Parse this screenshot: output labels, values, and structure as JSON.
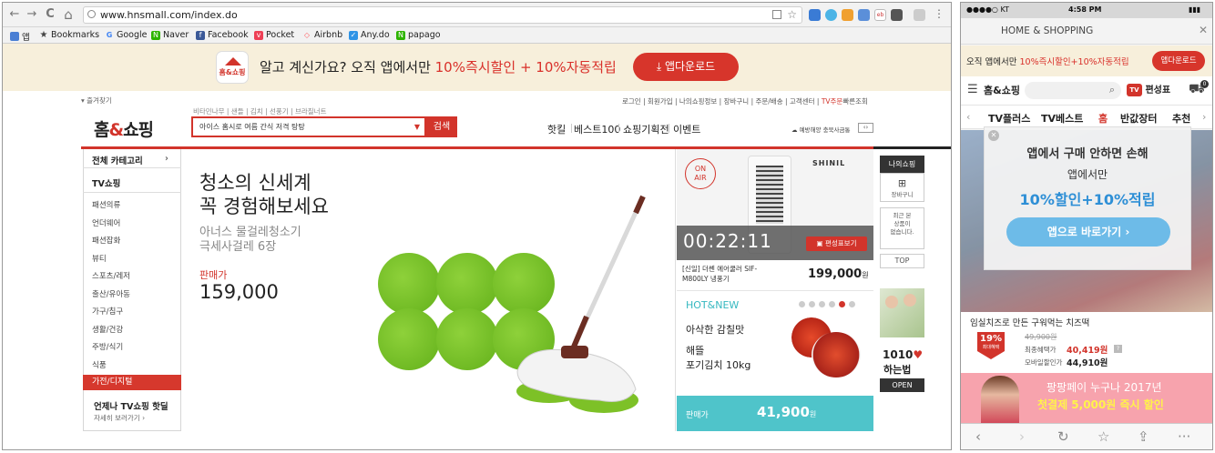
{
  "desktop": {
    "nav_icons": {
      "back": "←",
      "forward": "→",
      "reload": "C",
      "home": "⌂"
    },
    "url": "www.hnsmall.com/index.do",
    "bookmarks": [
      {
        "label": "앱",
        "icon": "apps-icon"
      },
      {
        "label": "Bookmarks",
        "icon": "star-icon"
      },
      {
        "label": "Google",
        "icon": "google-icon"
      },
      {
        "label": "Naver",
        "icon": "naver-icon"
      },
      {
        "label": "Facebook",
        "icon": "facebook-icon"
      },
      {
        "label": "Pocket",
        "icon": "pocket-icon"
      },
      {
        "label": "Airbnb",
        "icon": "airbnb-icon"
      },
      {
        "label": "Any.do",
        "icon": "anydo-icon"
      },
      {
        "label": "papago",
        "icon": "papago-icon"
      }
    ],
    "banner": {
      "logo_text": "홈&쇼핑",
      "text_plain": "알고 계신가요? 오직 앱에서만 ",
      "text_highlight": "10%즉시할인 + 10%자동적립",
      "download_label": "앱다운로드",
      "download_icon": "download-icon"
    },
    "header": {
      "favorites": "즐겨찾기",
      "logo": "홈",
      "logo_amp": "&",
      "logo_end": "쇼핑",
      "quick_links": "비타민나무 | 샌들 | 김치 | 선풍기 | 브라질너트",
      "search_value": "아이스 홈시로 여름 간식 저격 탕탕",
      "search_button": "검색",
      "util_links": "로그인 | 회원가입 | 나의쇼핑정보 | 장바구니 | 주문/배송 | 고객센터 |",
      "util_highlight": "TV주문",
      "util_end": "빠른조회",
      "nav": [
        "핫킬",
        "베스트100",
        "쇼핑기획전",
        "이벤트"
      ],
      "weather": "예방해양 충북사금통"
    },
    "categories": {
      "all": "전체 카테고리",
      "tv": "TV쇼핑",
      "items": [
        "패션의류",
        "언더웨어",
        "패션잡화",
        "뷰티",
        "스포츠/레저",
        "출산/유아동",
        "가구/침구",
        "생활/건강",
        "주방/식기",
        "식품"
      ],
      "active": "가전/디지털",
      "promo_title": "언제나 TV쇼핑 핫딜",
      "promo_link": "자세히 보러가기 ›"
    },
    "hero": {
      "title_line1": "청소의 신세계",
      "title_line2": "꼭 경험해보세요",
      "sub_line1": "아너스 물걸레청소기",
      "sub_line2": "극세사걸레 6장",
      "price_label": "판매가",
      "price": "159,000"
    },
    "onair": {
      "badge_line1": "ON",
      "badge_line2": "AIR",
      "brand": "SHINIL",
      "timer": "00:22:11",
      "schedule_button": "편성표보기",
      "product_line1": "[신일] 더쎈 에어쿨러 SIF-",
      "product_line2": "M800LY 냉풍기",
      "price": "199,000",
      "price_unit": "원"
    },
    "hotnew": {
      "title": "HOT&NEW",
      "dots": 6,
      "active_dot": 5,
      "line1": "아삭한 감칠맛",
      "line2": "해뜰",
      "line3": "포기김치 10kg",
      "price_label": "판매가",
      "price": "41,900",
      "price_unit": "원"
    },
    "side": {
      "myshopping": "나의쇼핑",
      "cart": "장바구니",
      "recent": "최근 본\n상품이\n없습니다.",
      "top": "TOP",
      "ad_big": "1010",
      "ad_small": "하는법",
      "open": "OPEN"
    }
  },
  "mobile": {
    "status": {
      "carrier": "●●●●○ KT",
      "time": "4:58 PM",
      "battery": "▮▮▮"
    },
    "page_title": "HOME & SHOPPING",
    "close": "✕",
    "banner_plain": "오직 앱에서만 ",
    "banner_highlight": "10%즉시할인+10%자동적립",
    "banner_button": "앱다운로드",
    "logo": "홈&쇼핑",
    "schedule": "편성표",
    "cart_count": "0",
    "tabs": [
      "TV플러스",
      "TV베스트",
      "홈",
      "반값장터",
      "추천"
    ],
    "active_tab": "홈",
    "popup": {
      "line1": "앱에서 구매 안하면 손해",
      "line2": "앱에서만",
      "line3": "10%할인+10%적립",
      "button": "앱으로 바로가기 ›"
    },
    "product": {
      "title": "임실치즈로 만든 구워먹는 치즈떡",
      "discount": "19%",
      "discount_sub": "최대혜택",
      "original": "49,900원",
      "benefit_label": "최종혜택가",
      "benefit_price": "40,419원",
      "mobile_label": "모바일할인가",
      "mobile_price": "44,910원"
    },
    "promo_line1": "팡팡페이 누구나 2017년",
    "promo_line2": "첫결제 5,000원 즉시 할인",
    "bottom_icons": [
      "back-icon",
      "forward-icon",
      "reload-icon",
      "bookmark-icon",
      "share-icon",
      "more-icon"
    ]
  }
}
